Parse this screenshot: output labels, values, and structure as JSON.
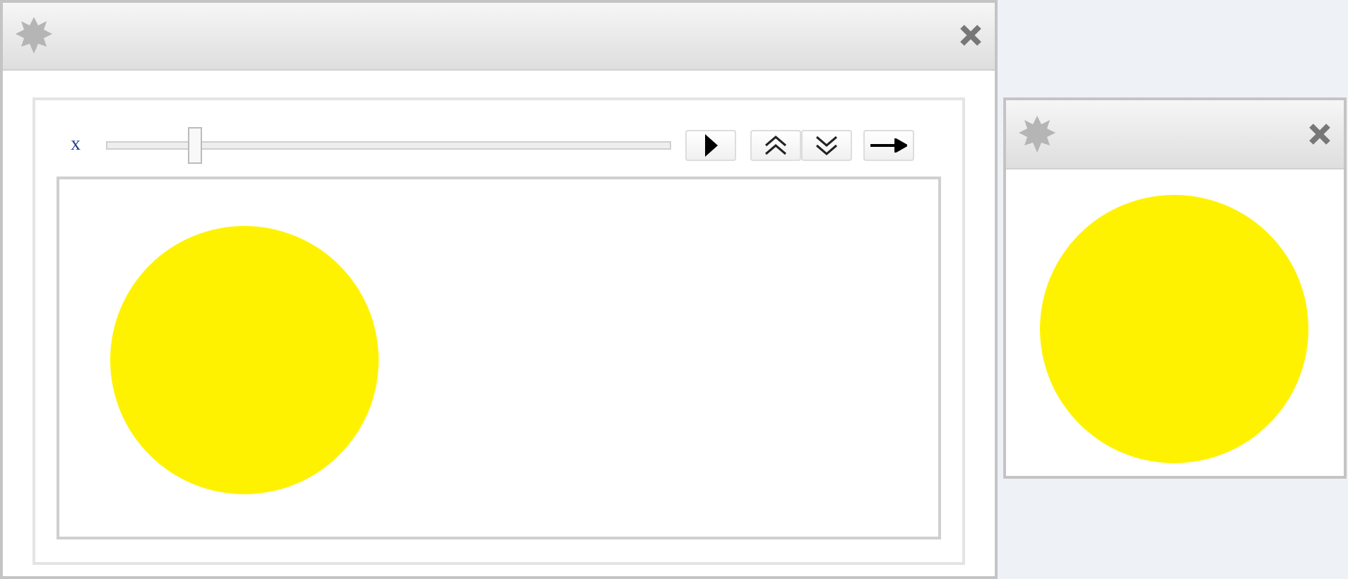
{
  "windows": [
    {
      "kind": "manipulate",
      "slider": {
        "label": "x",
        "level": 0.16
      }
    },
    {
      "kind": "graphic"
    }
  ]
}
